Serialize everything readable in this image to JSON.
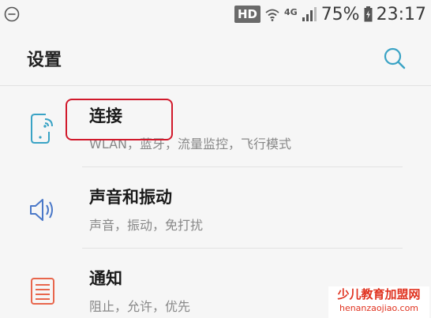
{
  "status_bar": {
    "hd": "HD",
    "network": "4G",
    "battery": "75%",
    "time": "23:17"
  },
  "header": {
    "title": "设置"
  },
  "items": [
    {
      "title": "连接",
      "subtitle": "WLAN，蓝牙，流量监控，飞行模式",
      "icon": "connection-icon"
    },
    {
      "title": "声音和振动",
      "subtitle": "声音，振动，免打扰",
      "icon": "sound-icon"
    },
    {
      "title": "通知",
      "subtitle": "阻止，允许，优先",
      "icon": "notification-icon"
    }
  ],
  "watermark": {
    "line1": "少儿教育加盟网",
    "line2": "henanzaojiao.com"
  },
  "colors": {
    "accent": "#3aa3c5",
    "highlight": "#d1192b",
    "sound_icon": "#4a78c8",
    "notify_icon": "#e8664c"
  }
}
